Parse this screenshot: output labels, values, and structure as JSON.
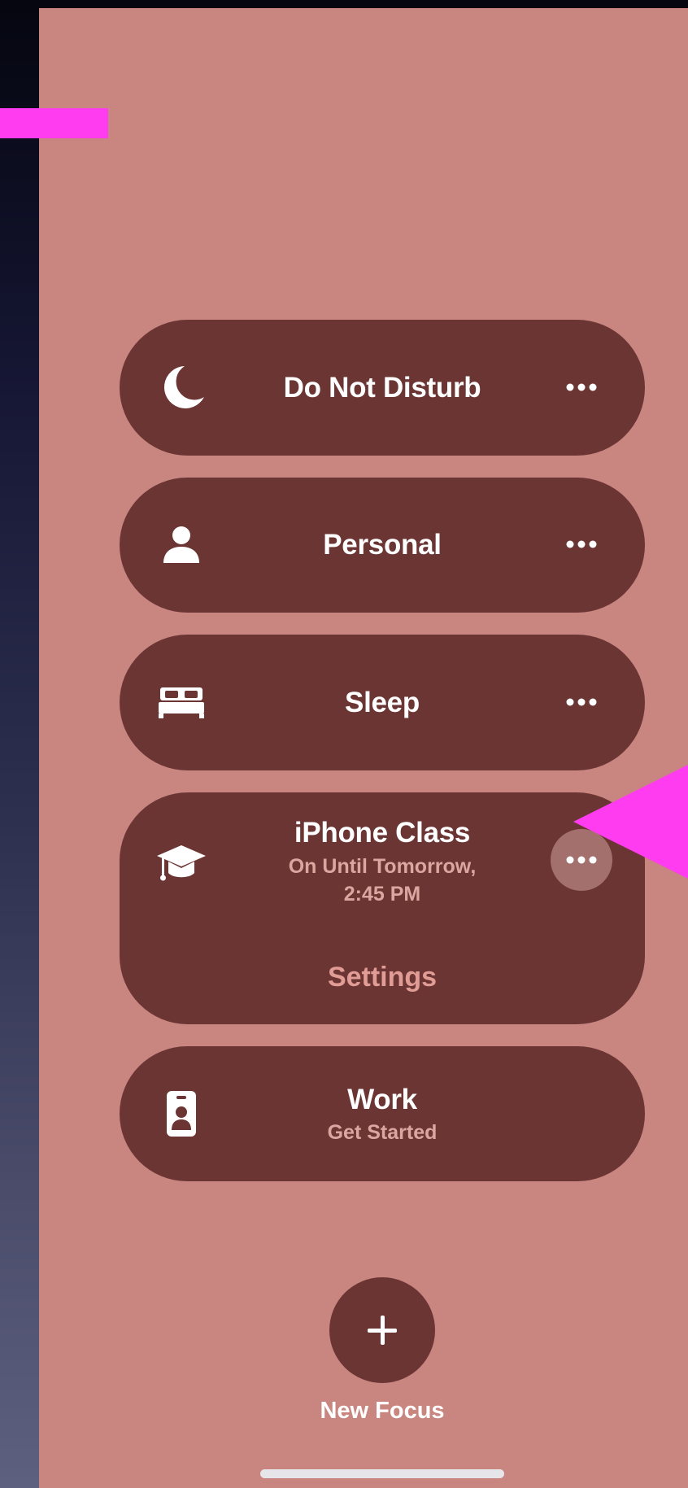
{
  "focus_list": [
    {
      "title": "Do Not Disturb",
      "icon": "moon-icon"
    },
    {
      "title": "Personal",
      "icon": "person-icon"
    },
    {
      "title": "Sleep",
      "icon": "bed-icon"
    },
    {
      "title": "iPhone Class",
      "icon": "graduation-cap-icon",
      "subtitle_line1": "On Until Tomorrow,",
      "subtitle_line2": "2:45 PM",
      "settings_label": "Settings",
      "active": true
    },
    {
      "title": "Work",
      "icon": "id-badge-icon",
      "subtitle": "Get Started"
    }
  ],
  "new_focus": {
    "label": "New Focus",
    "icon": "plus-icon"
  },
  "more_icon": "ellipsis-icon",
  "colors": {
    "background": "#c98580",
    "pill": "#6b3534",
    "active_more_button": "#a4706d",
    "accent_text": "#e29c96",
    "annotation": "#ff3cf0"
  }
}
